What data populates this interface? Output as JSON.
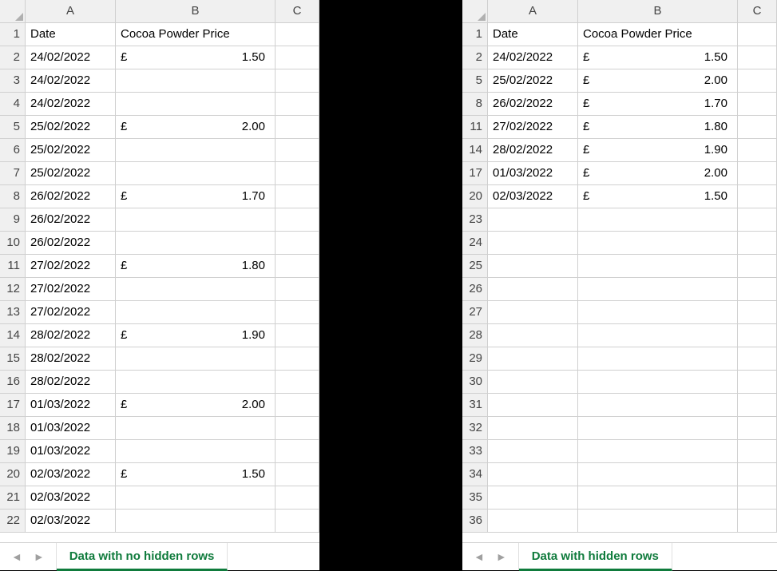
{
  "colHeaders": [
    "A",
    "B",
    "C"
  ],
  "headersRow": {
    "date": "Date",
    "price": "Cocoa Powder Price"
  },
  "currency": "£",
  "leftPane": {
    "tabLabel": "Data with no hidden rows",
    "rows": [
      {
        "n": 1,
        "date": "Date",
        "price": "Cocoa Powder Price",
        "header": true
      },
      {
        "n": 2,
        "date": "24/02/2022",
        "price": "1.50"
      },
      {
        "n": 3,
        "date": "24/02/2022",
        "price": ""
      },
      {
        "n": 4,
        "date": "24/02/2022",
        "price": ""
      },
      {
        "n": 5,
        "date": "25/02/2022",
        "price": "2.00"
      },
      {
        "n": 6,
        "date": "25/02/2022",
        "price": ""
      },
      {
        "n": 7,
        "date": "25/02/2022",
        "price": ""
      },
      {
        "n": 8,
        "date": "26/02/2022",
        "price": "1.70"
      },
      {
        "n": 9,
        "date": "26/02/2022",
        "price": ""
      },
      {
        "n": 10,
        "date": "26/02/2022",
        "price": ""
      },
      {
        "n": 11,
        "date": "27/02/2022",
        "price": "1.80"
      },
      {
        "n": 12,
        "date": "27/02/2022",
        "price": ""
      },
      {
        "n": 13,
        "date": "27/02/2022",
        "price": ""
      },
      {
        "n": 14,
        "date": "28/02/2022",
        "price": "1.90"
      },
      {
        "n": 15,
        "date": "28/02/2022",
        "price": ""
      },
      {
        "n": 16,
        "date": "28/02/2022",
        "price": ""
      },
      {
        "n": 17,
        "date": "01/03/2022",
        "price": "2.00"
      },
      {
        "n": 18,
        "date": "01/03/2022",
        "price": ""
      },
      {
        "n": 19,
        "date": "01/03/2022",
        "price": ""
      },
      {
        "n": 20,
        "date": "02/03/2022",
        "price": "1.50"
      },
      {
        "n": 21,
        "date": "02/03/2022",
        "price": ""
      },
      {
        "n": 22,
        "date": "02/03/2022",
        "price": ""
      }
    ]
  },
  "rightPane": {
    "tabLabel": "Data with hidden rows",
    "rows": [
      {
        "n": 1,
        "date": "Date",
        "price": "Cocoa Powder Price",
        "header": true
      },
      {
        "n": 2,
        "date": "24/02/2022",
        "price": "1.50"
      },
      {
        "n": 5,
        "date": "25/02/2022",
        "price": "2.00"
      },
      {
        "n": 8,
        "date": "26/02/2022",
        "price": "1.70"
      },
      {
        "n": 11,
        "date": "27/02/2022",
        "price": "1.80"
      },
      {
        "n": 14,
        "date": "28/02/2022",
        "price": "1.90"
      },
      {
        "n": 17,
        "date": "01/03/2022",
        "price": "2.00"
      },
      {
        "n": 20,
        "date": "02/03/2022",
        "price": "1.50"
      },
      {
        "n": 23,
        "date": "",
        "price": ""
      },
      {
        "n": 24,
        "date": "",
        "price": ""
      },
      {
        "n": 25,
        "date": "",
        "price": ""
      },
      {
        "n": 26,
        "date": "",
        "price": ""
      },
      {
        "n": 27,
        "date": "",
        "price": ""
      },
      {
        "n": 28,
        "date": "",
        "price": ""
      },
      {
        "n": 29,
        "date": "",
        "price": ""
      },
      {
        "n": 30,
        "date": "",
        "price": ""
      },
      {
        "n": 31,
        "date": "",
        "price": ""
      },
      {
        "n": 32,
        "date": "",
        "price": ""
      },
      {
        "n": 33,
        "date": "",
        "price": ""
      },
      {
        "n": 34,
        "date": "",
        "price": ""
      },
      {
        "n": 35,
        "date": "",
        "price": ""
      },
      {
        "n": 36,
        "date": "",
        "price": ""
      }
    ]
  },
  "nav": {
    "prev": "◄",
    "next": "►"
  }
}
